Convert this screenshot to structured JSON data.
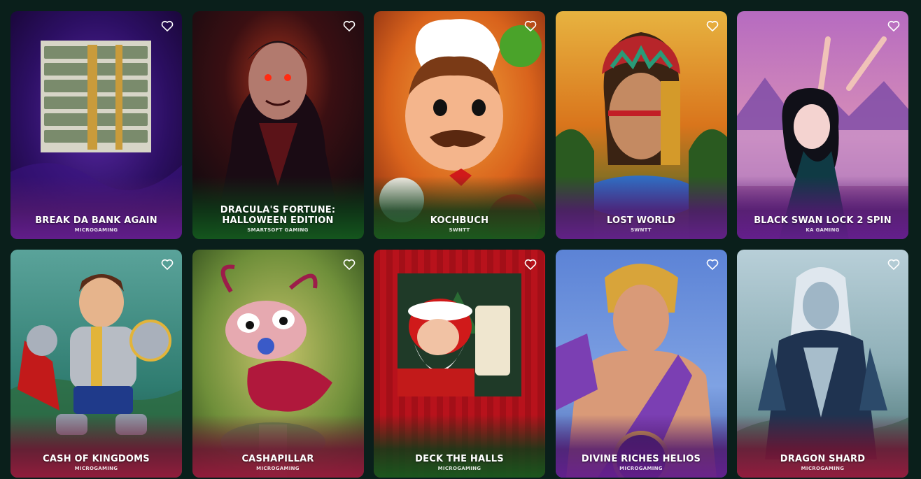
{
  "games": [
    {
      "title": "BREAK DA BANK AGAIN",
      "provider": "MICROGAMING",
      "theme": "purple-velvet",
      "icon": "money-stack-icon"
    },
    {
      "title": "DRACULA'S FORTUNE: HALLOWEEN EDITION",
      "provider": "SMARTSOFT GAMING",
      "theme": "dark-vampire",
      "icon": "vampire-icon"
    },
    {
      "title": "KOCHBUCH",
      "provider": "SWNTT",
      "theme": "orange-chef",
      "icon": "chef-icon"
    },
    {
      "title": "LOST WORLD",
      "provider": "SWNTT",
      "theme": "jungle-warrior",
      "icon": "warrior-woman-icon"
    },
    {
      "title": "BLACK SWAN LOCK 2 SPIN",
      "provider": "KA GAMING",
      "theme": "pink-dancer",
      "icon": "ballerina-icon"
    },
    {
      "title": "CASH OF KINGDOMS",
      "provider": "MICROGAMING",
      "theme": "teal-knight",
      "icon": "knight-icon"
    },
    {
      "title": "CASHAPILLAR",
      "provider": "MICROGAMING",
      "theme": "green-bug",
      "icon": "caterpillar-icon"
    },
    {
      "title": "DECK THE HALLS",
      "provider": "MICROGAMING",
      "theme": "red-santa",
      "icon": "santa-icon"
    },
    {
      "title": "DIVINE RICHES HELIOS",
      "provider": "MICROGAMING",
      "theme": "blue-god",
      "icon": "helios-icon"
    },
    {
      "title": "DRAGON SHARD",
      "provider": "MICROGAMING",
      "theme": "misty-elf",
      "icon": "elf-warrior-icon"
    }
  ],
  "favorite_icon": "heart-outline-icon",
  "colors": {
    "page_bg": "#0a1f1b",
    "text": "#ffffff"
  }
}
